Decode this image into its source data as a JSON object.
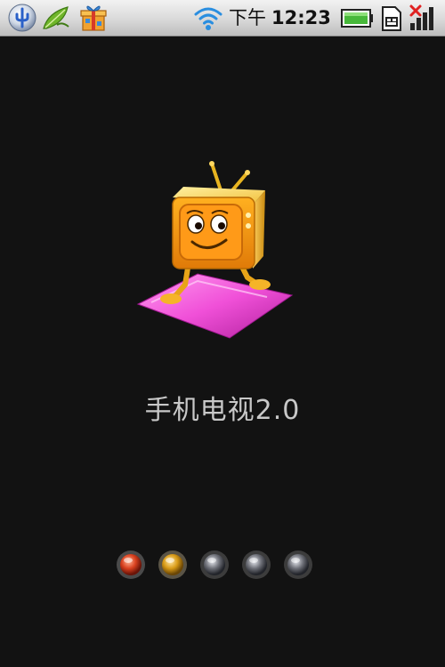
{
  "status_bar": {
    "ampm": "下午",
    "time": "12:23",
    "icons": [
      "usb-connected-icon",
      "leaf-app-icon",
      "gift-box-app-icon",
      "wifi-icon",
      "battery-icon",
      "sim-card-icon",
      "signal-strength-no-service-icon"
    ]
  },
  "splash": {
    "mascot": "tv-mascot-icon",
    "title": "手机电视2.0"
  },
  "pager": {
    "dot_count": 5,
    "dot_colors": [
      "#d9401e",
      "#d89a16",
      "#6e7078",
      "#6e7078",
      "#6e7078"
    ]
  }
}
